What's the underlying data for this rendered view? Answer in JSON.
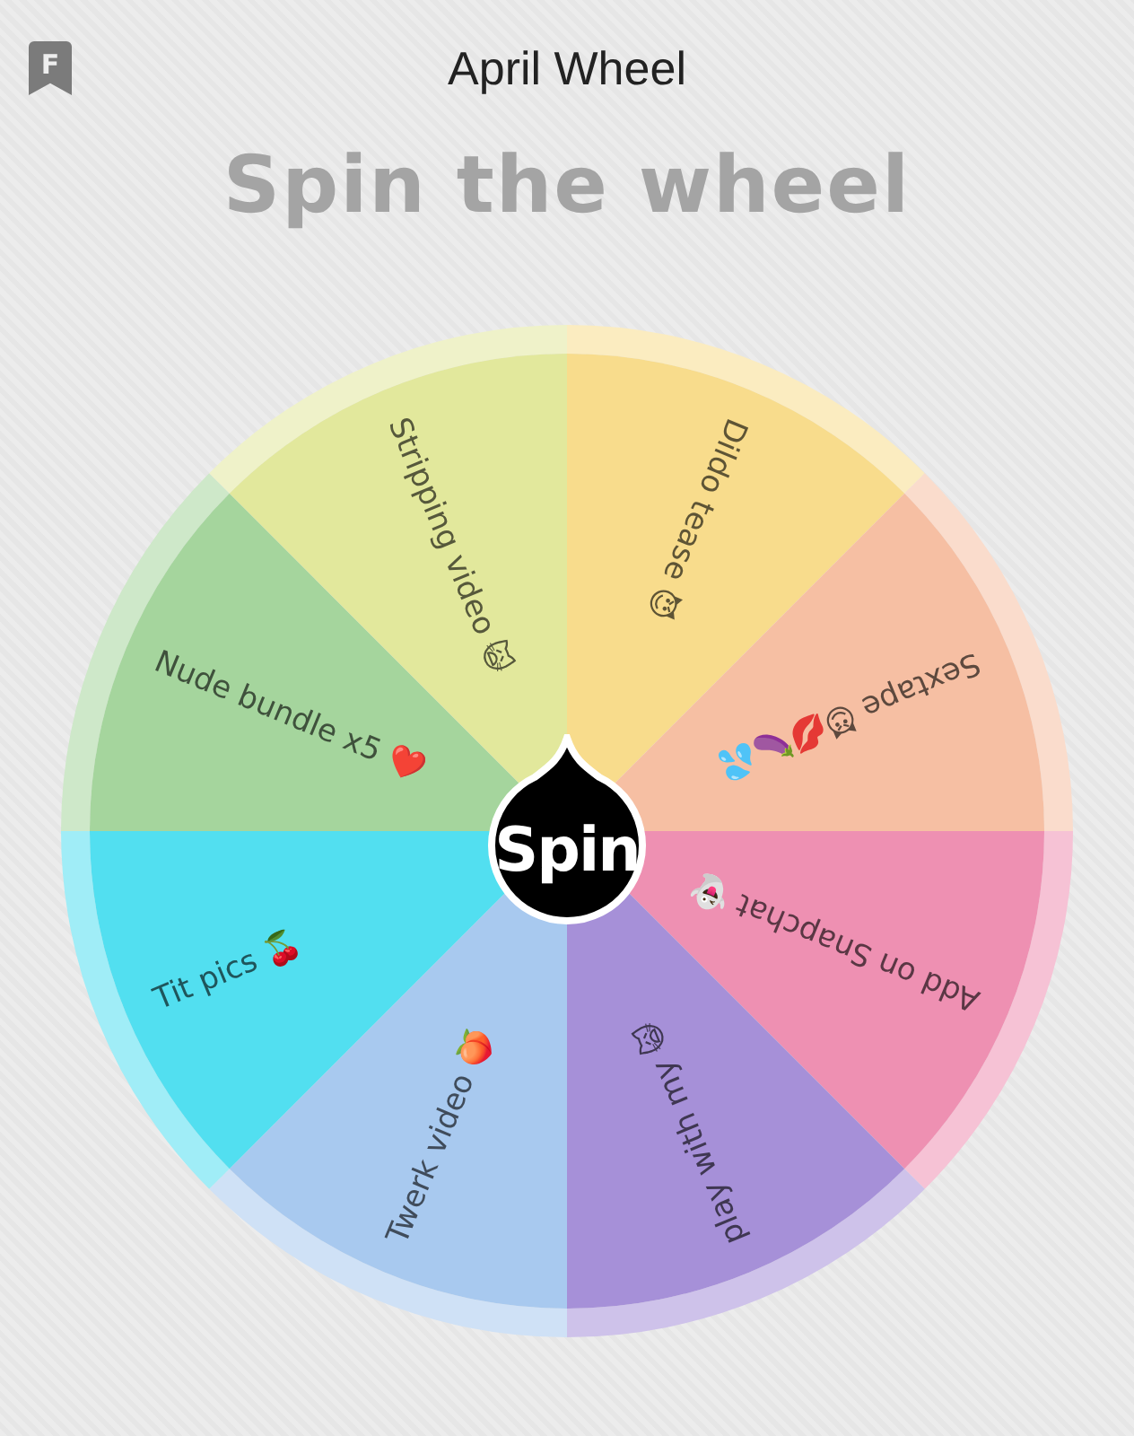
{
  "app_badge": {
    "label": "F"
  },
  "title": "April Wheel",
  "heading": "Spin the wheel",
  "wheel": {
    "segments": [
      {
        "label": "Dildo tease 😈",
        "color": "#f8dc8c"
      },
      {
        "label": "Sextape 😈💋🍆💦",
        "color": "#f6bfa3"
      },
      {
        "label": "Add on Snapchat 👻",
        "color": "#ee90b2"
      },
      {
        "label": "play with my 🙀",
        "color": "#a690d8"
      },
      {
        "label": "Twerk video 🍑",
        "color": "#a8c9ef"
      },
      {
        "label": "Tit pics 🍒",
        "color": "#52dff0"
      },
      {
        "label": "Nude bundle x5 ❤️",
        "color": "#a5d59d"
      },
      {
        "label": "Stripping video 🙀",
        "color": "#e2e89c"
      }
    ]
  },
  "spin_button": {
    "label": "Spin"
  }
}
